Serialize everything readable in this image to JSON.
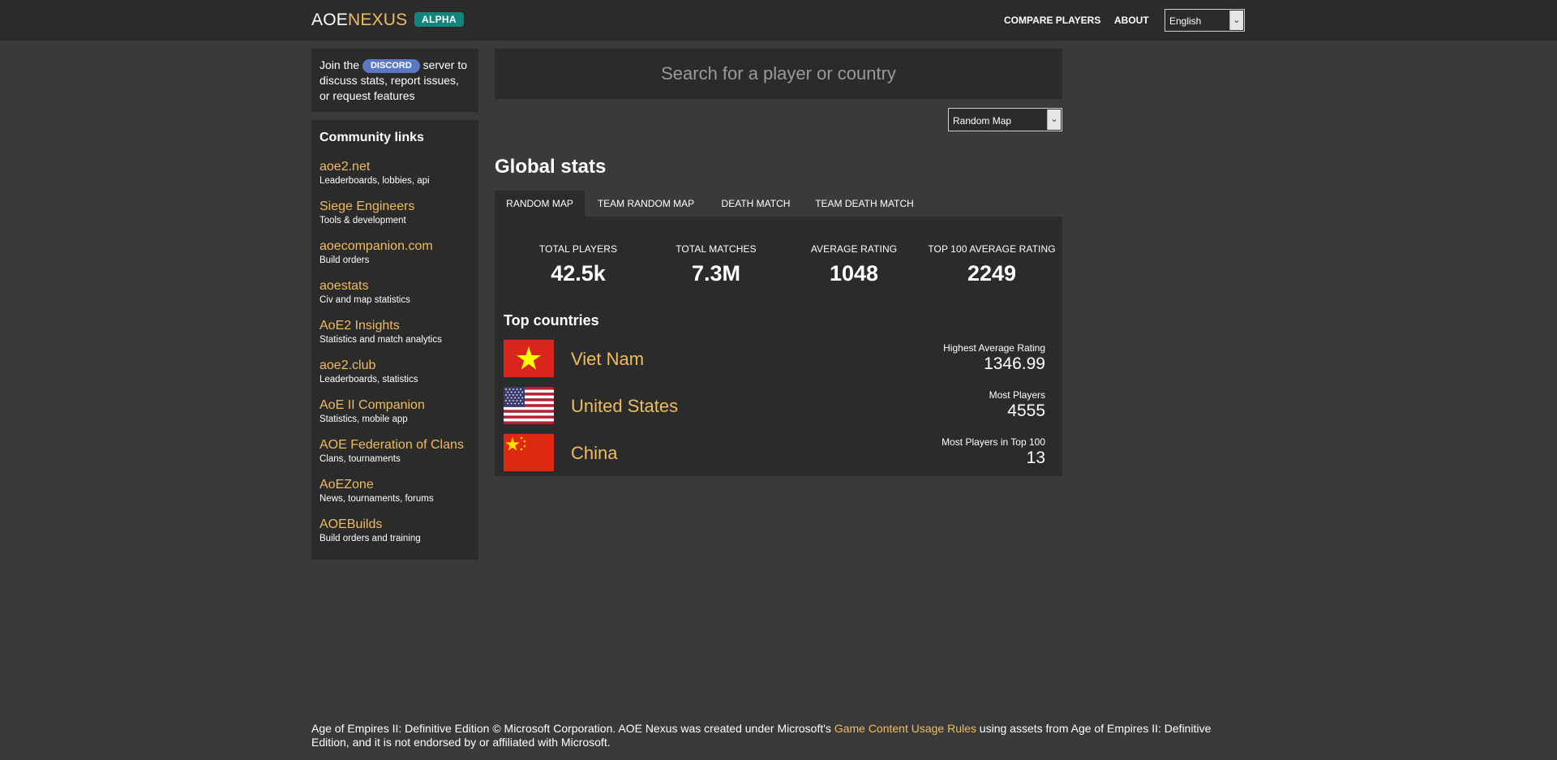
{
  "header": {
    "logo_part1": "AOE",
    "logo_part2": "NEXUS",
    "badge": "ALPHA",
    "nav": [
      "COMPARE PLAYERS",
      "ABOUT"
    ],
    "language": "English"
  },
  "sidebar": {
    "discord": {
      "pre": "Join the",
      "badge": "DISCORD",
      "post": "server to discuss stats, report issues, or request features"
    },
    "community": {
      "title": "Community links",
      "links": [
        {
          "name": "aoe2.net",
          "desc": "Leaderboards, lobbies, api"
        },
        {
          "name": "Siege Engineers",
          "desc": "Tools & development"
        },
        {
          "name": "aoecompanion.com",
          "desc": "Build orders"
        },
        {
          "name": "aoestats",
          "desc": "Civ and map statistics"
        },
        {
          "name": "AoE2 Insights",
          "desc": "Statistics and match analytics"
        },
        {
          "name": "aoe2.club",
          "desc": "Leaderboards, statistics"
        },
        {
          "name": "AoE II Companion",
          "desc": "Statistics, mobile app"
        },
        {
          "name": "AOE Federation of Clans",
          "desc": "Clans, tournaments"
        },
        {
          "name": "AoEZone",
          "desc": "News, tournaments, forums"
        },
        {
          "name": "AOEBuilds",
          "desc": "Build orders and training"
        }
      ]
    }
  },
  "main": {
    "search_placeholder": "Search for a player or country",
    "map_filter": "Random Map",
    "title": "Global stats",
    "tabs": [
      "RANDOM MAP",
      "TEAM RANDOM MAP",
      "DEATH MATCH",
      "TEAM DEATH MATCH"
    ],
    "active_tab": "RANDOM MAP",
    "stats": [
      {
        "label": "TOTAL PLAYERS",
        "value": "42.5k"
      },
      {
        "label": "TOTAL MATCHES",
        "value": "7.3M"
      },
      {
        "label": "AVERAGE RATING",
        "value": "1048"
      },
      {
        "label": "TOP 100 AVERAGE RATING",
        "value": "2249"
      }
    ],
    "top_countries": {
      "title": "Top countries",
      "rows": [
        {
          "country": "Viet Nam",
          "flag": "vietnam-flag-icon",
          "stat_label": "Highest Average Rating",
          "stat_value": "1346.99"
        },
        {
          "country": "United States",
          "flag": "usa-flag-icon",
          "stat_label": "Most Players",
          "stat_value": "4555"
        },
        {
          "country": "China",
          "flag": "china-flag-icon",
          "stat_label": "Most Players in Top 100",
          "stat_value": "13"
        }
      ]
    }
  },
  "footer": {
    "pre": "Age of Empires II: Definitive Edition © Microsoft Corporation. AOE Nexus was created under Microsoft's",
    "link": "Game Content Usage Rules",
    "post": "using assets from Age of Empires II: Definitive Edition, and it is not endorsed by or affiliated with Microsoft."
  },
  "colors": {
    "background": "#3a3a3a",
    "panel": "#2b2b2b",
    "accent_gold": "#f0bc5e",
    "alpha_badge": "#12857d",
    "discord_badge": "#5b78c7"
  }
}
